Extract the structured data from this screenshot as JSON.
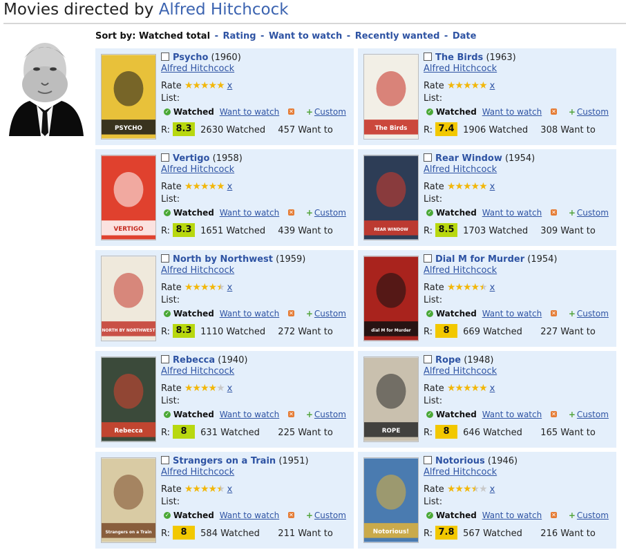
{
  "header": {
    "title_prefix": "Movies directed by",
    "director": "Alfred Hitchcock"
  },
  "sort": {
    "label": "Sort by:",
    "active": "Watched total",
    "options": [
      "Rating",
      "Want to watch",
      "Recently wanted",
      "Date"
    ],
    "separator": "-"
  },
  "labels": {
    "rate": "Rate",
    "list": "List:",
    "watched": "Watched",
    "want_to_watch": "Want to watch",
    "custom": "Custom",
    "clear_rating": "x",
    "r": "R:",
    "watched_suffix": "Watched",
    "want_suffix": "Want to"
  },
  "colors": {
    "badge_green": "#b8d80f",
    "badge_yellow": "#f2c800",
    "card_bg": "#e4effb",
    "link": "#2e53a3"
  },
  "movies": [
    {
      "title": "Psycho",
      "year": "(1960)",
      "director": "Alfred Hitchcock",
      "stars": 5,
      "rating": "8.3",
      "badge": "green",
      "watched": 2630,
      "want": 457
    },
    {
      "title": "The Birds",
      "year": "(1963)",
      "director": "Alfred Hitchcock",
      "stars": 5,
      "rating": "7.4",
      "badge": "yellow",
      "watched": 1906,
      "want": 308
    },
    {
      "title": "Vertigo",
      "year": "(1958)",
      "director": "Alfred Hitchcock",
      "stars": 5,
      "rating": "8.3",
      "badge": "green",
      "watched": 1651,
      "want": 439
    },
    {
      "title": "Rear Window",
      "year": "(1954)",
      "director": "Alfred Hitchcock",
      "stars": 5,
      "rating": "8.5",
      "badge": "green",
      "watched": 1703,
      "want": 309
    },
    {
      "title": "North by Northwest",
      "year": "(1959)",
      "director": "Alfred Hitchcock",
      "stars": 4.5,
      "rating": "8.3",
      "badge": "green",
      "watched": 1110,
      "want": 272
    },
    {
      "title": "Dial M for Murder",
      "year": "(1954)",
      "director": "Alfred Hitchcock",
      "stars": 4.5,
      "rating": "8",
      "badge": "yellow",
      "watched": 669,
      "want": 227
    },
    {
      "title": "Rebecca",
      "year": "(1940)",
      "director": "Alfred Hitchcock",
      "stars": 4,
      "rating": "8",
      "badge": "green",
      "watched": 631,
      "want": 225
    },
    {
      "title": "Rope",
      "year": "(1948)",
      "director": "Alfred Hitchcock",
      "stars": 5,
      "rating": "8",
      "badge": "yellow",
      "watched": 646,
      "want": 165
    },
    {
      "title": "Strangers on a Train",
      "year": "(1951)",
      "director": "Alfred Hitchcock",
      "stars": 4.5,
      "rating": "8",
      "badge": "yellow",
      "watched": 584,
      "want": 211
    },
    {
      "title": "Notorious",
      "year": "(1946)",
      "director": "Alfred Hitchcock",
      "stars": 3.5,
      "rating": "7.8",
      "badge": "yellow",
      "watched": 567,
      "want": 216
    }
  ],
  "posters": [
    {
      "bg": "#e8c13a",
      "accent": "#1a1a1a",
      "text": "PSYCHO"
    },
    {
      "bg": "#f2efe6",
      "accent": "#c42a1f",
      "text": "The Birds"
    },
    {
      "bg": "#e0412e",
      "accent": "#ffffff",
      "text": "VERTIGO"
    },
    {
      "bg": "#2d3d56",
      "accent": "#d63a2a",
      "text": "REAR WINDOW"
    },
    {
      "bg": "#efe9dc",
      "accent": "#c2362b",
      "text": "NORTH BY NORTHWEST"
    },
    {
      "bg": "#a9231d",
      "accent": "#111111",
      "text": "dial M for Murder"
    },
    {
      "bg": "#3b4a3a",
      "accent": "#d9442f",
      "text": "Rebecca"
    },
    {
      "bg": "#c9c0ae",
      "accent": "#2a2a2a",
      "text": "ROPE"
    },
    {
      "bg": "#d9cba4",
      "accent": "#7a4b2a",
      "text": "Strangers on a Train"
    },
    {
      "bg": "#4a7bb0",
      "accent": "#e0b33a",
      "text": "Notorious!"
    }
  ]
}
